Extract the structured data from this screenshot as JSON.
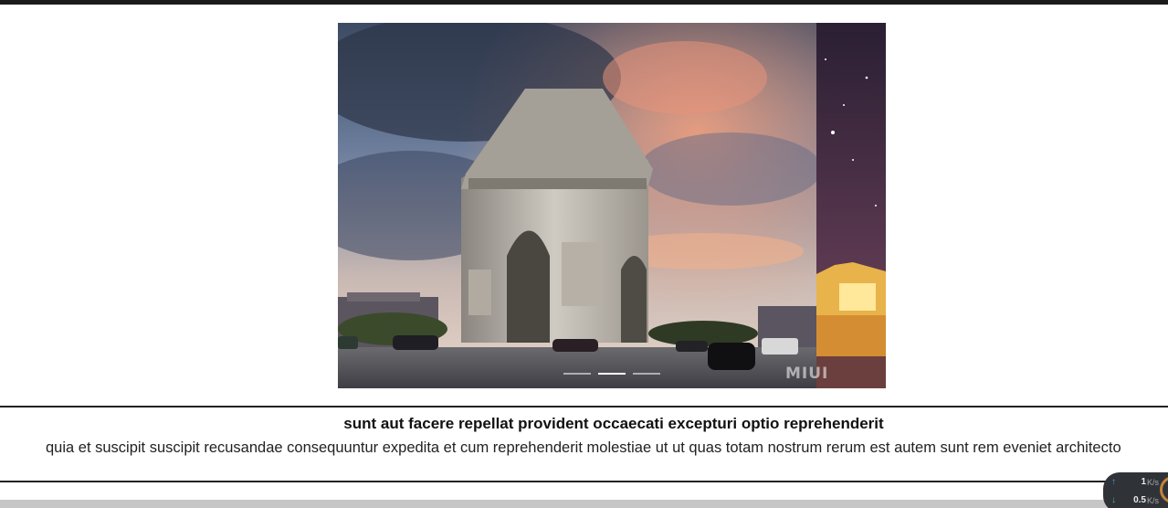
{
  "carousel": {
    "slides": [
      {
        "label": "arc-de-triomphe-slide"
      },
      {
        "label": "night-building-slide"
      }
    ],
    "active_index": 1,
    "indicator_count": 3,
    "watermark": "MIUI"
  },
  "post": {
    "title": "sunt aut facere repellat provident occaecati excepturi optio reprehenderit",
    "body": "quia et suscipit suscipit recusandae consequuntur expedita et cum reprehenderit molestiae ut ut quas totam nostrum rerum est autem sunt rem eveniet architecto"
  },
  "net_speed": {
    "upload_value": "1",
    "upload_unit": "K/s",
    "download_value": "0.5",
    "download_unit": "K/s"
  },
  "colors": {
    "top_bar": "#1b1b1b",
    "rule": "#222222",
    "widget_bg": "#2f3338",
    "upload_arrow": "#34a4e6",
    "download_arrow": "#3fc35a"
  }
}
